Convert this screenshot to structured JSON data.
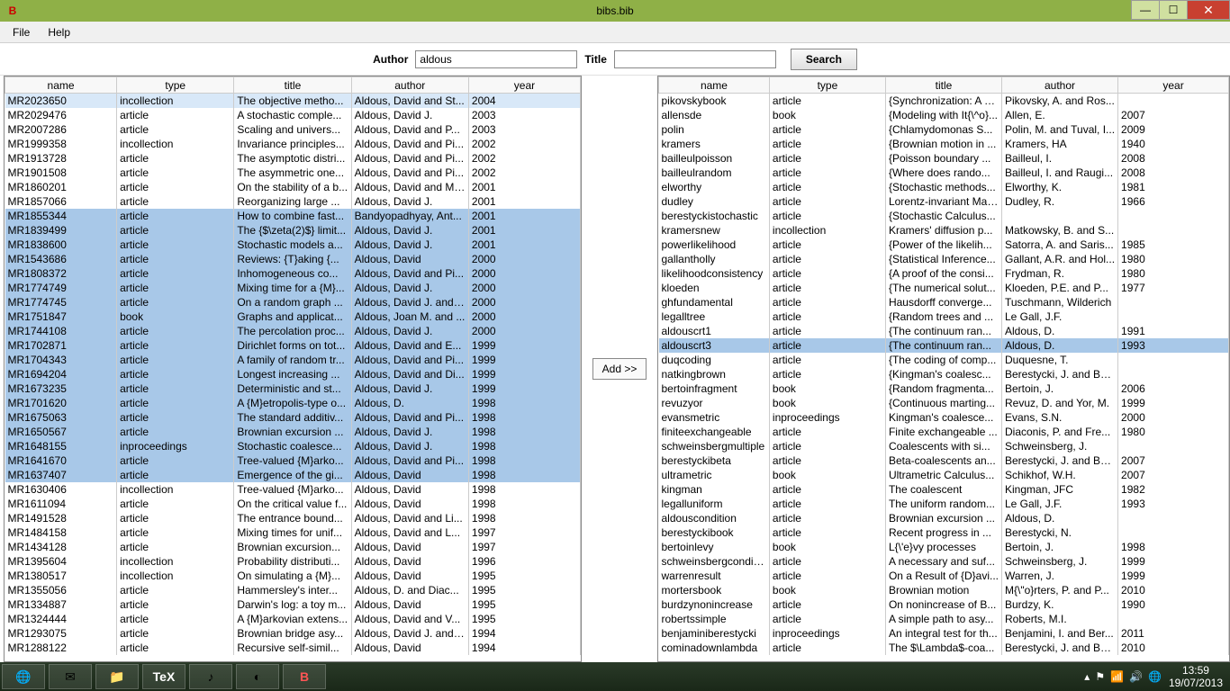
{
  "window": {
    "title": "bibs.bib"
  },
  "menu": {
    "file": "File",
    "help": "Help"
  },
  "search": {
    "author_label": "Author",
    "author_value": "aldous",
    "title_label": "Title",
    "title_value": "",
    "button": "Search"
  },
  "add_button": "Add >>",
  "columns": {
    "name": "name",
    "type": "type",
    "title": "title",
    "author": "author",
    "year": "year"
  },
  "left_rows": [
    {
      "sel": "partial",
      "name": "MR2023650",
      "type": "incollection",
      "title": "The objective metho...",
      "author": "Aldous, David and St...",
      "year": "2004"
    },
    {
      "sel": "",
      "name": "MR2029476",
      "type": "article",
      "title": "A stochastic comple...",
      "author": "Aldous, David J.",
      "year": "2003"
    },
    {
      "sel": "",
      "name": "MR2007286",
      "type": "article",
      "title": "Scaling and univers...",
      "author": "Aldous, David and P...",
      "year": "2003"
    },
    {
      "sel": "",
      "name": "MR1999358",
      "type": "incollection",
      "title": "Invariance principles...",
      "author": "Aldous, David and Pi...",
      "year": "2002"
    },
    {
      "sel": "",
      "name": "MR1913728",
      "type": "article",
      "title": "The asymptotic distri...",
      "author": "Aldous, David and Pi...",
      "year": "2002"
    },
    {
      "sel": "",
      "name": "MR1901508",
      "type": "article",
      "title": "The asymmetric one...",
      "author": "Aldous, David and Pi...",
      "year": "2002"
    },
    {
      "sel": "",
      "name": "MR1860201",
      "type": "article",
      "title": "On the stability of a b...",
      "author": "Aldous, David and Mi...",
      "year": "2001"
    },
    {
      "sel": "",
      "name": "MR1857066",
      "type": "article",
      "title": "Reorganizing large ...",
      "author": "Aldous, David J.",
      "year": "2001"
    },
    {
      "sel": "selected",
      "name": "MR1855344",
      "type": "article",
      "title": "How to combine fast...",
      "author": "Bandyopadhyay, Ant...",
      "year": "2001"
    },
    {
      "sel": "selected",
      "name": "MR1839499",
      "type": "article",
      "title": "The {$\\zeta(2)$} limit...",
      "author": "Aldous, David J.",
      "year": "2001"
    },
    {
      "sel": "selected",
      "name": "MR1838600",
      "type": "article",
      "title": "Stochastic models a...",
      "author": "Aldous, David J.",
      "year": "2001"
    },
    {
      "sel": "selected",
      "name": "MR1543686",
      "type": "article",
      "title": "Reviews: {T}aking {...",
      "author": "Aldous, David",
      "year": "2000"
    },
    {
      "sel": "selected",
      "name": "MR1808372",
      "type": "article",
      "title": "Inhomogeneous co...",
      "author": "Aldous, David and Pi...",
      "year": "2000"
    },
    {
      "sel": "selected",
      "name": "MR1774749",
      "type": "article",
      "title": "Mixing time for a {M}...",
      "author": "Aldous, David J.",
      "year": "2000"
    },
    {
      "sel": "selected",
      "name": "MR1774745",
      "type": "article",
      "title": "On a random graph ...",
      "author": "Aldous, David J. and ...",
      "year": "2000"
    },
    {
      "sel": "selected",
      "name": "MR1751847",
      "type": "book",
      "title": "Graphs and applicat...",
      "author": "Aldous, Joan M. and ...",
      "year": "2000"
    },
    {
      "sel": "selected",
      "name": "MR1744108",
      "type": "article",
      "title": "The percolation proc...",
      "author": "Aldous, David J.",
      "year": "2000"
    },
    {
      "sel": "selected",
      "name": "MR1702871",
      "type": "article",
      "title": "Dirichlet forms on tot...",
      "author": "Aldous, David and E...",
      "year": "1999"
    },
    {
      "sel": "selected",
      "name": "MR1704343",
      "type": "article",
      "title": "A family of random tr...",
      "author": "Aldous, David and Pi...",
      "year": "1999"
    },
    {
      "sel": "selected",
      "name": "MR1694204",
      "type": "article",
      "title": "Longest increasing ...",
      "author": "Aldous, David and Di...",
      "year": "1999"
    },
    {
      "sel": "selected",
      "name": "MR1673235",
      "type": "article",
      "title": "Deterministic and st...",
      "author": "Aldous, David J.",
      "year": "1999"
    },
    {
      "sel": "selected",
      "name": "MR1701620",
      "type": "article",
      "title": "A {M}etropolis-type o...",
      "author": "Aldous, D.",
      "year": "1998"
    },
    {
      "sel": "selected",
      "name": "MR1675063",
      "type": "article",
      "title": "The standard additiv...",
      "author": "Aldous, David and Pi...",
      "year": "1998"
    },
    {
      "sel": "selected",
      "name": "MR1650567",
      "type": "article",
      "title": "Brownian excursion ...",
      "author": "Aldous, David J.",
      "year": "1998"
    },
    {
      "sel": "selected",
      "name": "MR1648155",
      "type": "inproceedings",
      "title": "Stochastic coalesce...",
      "author": "Aldous, David J.",
      "year": "1998"
    },
    {
      "sel": "selected",
      "name": "MR1641670",
      "type": "article",
      "title": "Tree-valued {M}arko...",
      "author": "Aldous, David and Pi...",
      "year": "1998"
    },
    {
      "sel": "selected",
      "name": "MR1637407",
      "type": "article",
      "title": "Emergence of the gi...",
      "author": "Aldous, David",
      "year": "1998"
    },
    {
      "sel": "",
      "name": "MR1630406",
      "type": "incollection",
      "title": "Tree-valued {M}arko...",
      "author": "Aldous, David",
      "year": "1998"
    },
    {
      "sel": "",
      "name": "MR1611094",
      "type": "article",
      "title": "On the critical value f...",
      "author": "Aldous, David",
      "year": "1998"
    },
    {
      "sel": "",
      "name": "MR1491528",
      "type": "article",
      "title": "The entrance bound...",
      "author": "Aldous, David and Li...",
      "year": "1998"
    },
    {
      "sel": "",
      "name": "MR1484158",
      "type": "article",
      "title": "Mixing times for unif...",
      "author": "Aldous, David and L...",
      "year": "1997"
    },
    {
      "sel": "",
      "name": "MR1434128",
      "type": "article",
      "title": "Brownian excursion...",
      "author": "Aldous, David",
      "year": "1997"
    },
    {
      "sel": "",
      "name": "MR1395604",
      "type": "incollection",
      "title": "Probability distributi...",
      "author": "Aldous, David",
      "year": "1996"
    },
    {
      "sel": "",
      "name": "MR1380517",
      "type": "incollection",
      "title": "On simulating a {M}...",
      "author": "Aldous, David",
      "year": "1995"
    },
    {
      "sel": "",
      "name": "MR1355056",
      "type": "article",
      "title": "Hammersley's inter...",
      "author": "Aldous, D. and Diac...",
      "year": "1995"
    },
    {
      "sel": "",
      "name": "MR1334887",
      "type": "article",
      "title": "Darwin's log: a toy m...",
      "author": "Aldous, David",
      "year": "1995"
    },
    {
      "sel": "",
      "name": "MR1324444",
      "type": "article",
      "title": "A {M}arkovian extens...",
      "author": "Aldous, David and V...",
      "year": "1995"
    },
    {
      "sel": "",
      "name": "MR1293075",
      "type": "article",
      "title": "Brownian bridge asy...",
      "author": "Aldous, David J. and ...",
      "year": "1994"
    },
    {
      "sel": "",
      "name": "MR1288122",
      "type": "article",
      "title": "Recursive self-simil...",
      "author": "Aldous, David",
      "year": "1994"
    }
  ],
  "right_rows": [
    {
      "sel": "",
      "name": "pikovskybook",
      "type": "article",
      "title": "{Synchronization: A u...",
      "author": "Pikovsky, A. and Ros...",
      "year": ""
    },
    {
      "sel": "",
      "name": "allensde",
      "type": "book",
      "title": "{Modeling with It{\\^o}...",
      "author": "Allen, E.",
      "year": "2007"
    },
    {
      "sel": "",
      "name": "polin",
      "type": "article",
      "title": "{Chlamydomonas S...",
      "author": "Polin, M. and Tuval, I...",
      "year": "2009"
    },
    {
      "sel": "",
      "name": "kramers",
      "type": "article",
      "title": "{Brownian motion in ...",
      "author": "Kramers, HA",
      "year": "1940"
    },
    {
      "sel": "",
      "name": "bailleulpoisson",
      "type": "article",
      "title": "{Poisson boundary ...",
      "author": "Bailleul, I.",
      "year": "2008"
    },
    {
      "sel": "",
      "name": "bailleulrandom",
      "type": "article",
      "title": "{Where does rando...",
      "author": "Bailleul, I. and Raugi...",
      "year": "2008"
    },
    {
      "sel": "",
      "name": "elworthy",
      "type": "article",
      "title": "{Stochastic methods...",
      "author": "Elworthy, K.",
      "year": "1981"
    },
    {
      "sel": "",
      "name": "dudley",
      "type": "article",
      "title": "Lorentz-invariant Mar...",
      "author": "Dudley, R.",
      "year": "1966"
    },
    {
      "sel": "",
      "name": "berestyckistochastic",
      "type": "article",
      "title": "{Stochastic Calculus...",
      "author": "",
      "year": ""
    },
    {
      "sel": "",
      "name": "kramersnew",
      "type": "incollection",
      "title": "Kramers' diffusion p...",
      "author": "Matkowsky, B. and S...",
      "year": ""
    },
    {
      "sel": "",
      "name": "powerlikelihood",
      "type": "article",
      "title": "{Power of the likelih...",
      "author": "Satorra, A. and Saris...",
      "year": "1985"
    },
    {
      "sel": "",
      "name": "gallantholly",
      "type": "article",
      "title": "{Statistical Inference...",
      "author": "Gallant, A.R. and Hol...",
      "year": "1980"
    },
    {
      "sel": "",
      "name": "likelihoodconsistency",
      "type": "article",
      "title": "{A proof of the consi...",
      "author": "Frydman, R.",
      "year": "1980"
    },
    {
      "sel": "",
      "name": "kloeden",
      "type": "article",
      "title": "{The numerical solut...",
      "author": "Kloeden, P.E. and P...",
      "year": "1977"
    },
    {
      "sel": "",
      "name": "ghfundamental",
      "type": "article",
      "title": "Hausdorff converge...",
      "author": "Tuschmann, Wilderich",
      "year": ""
    },
    {
      "sel": "",
      "name": "legalltree",
      "type": "article",
      "title": "{Random trees and ...",
      "author": "Le Gall, J.F.",
      "year": ""
    },
    {
      "sel": "",
      "name": "aldouscrt1",
      "type": "article",
      "title": "{The continuum ran...",
      "author": "Aldous, D.",
      "year": "1991"
    },
    {
      "sel": "selected",
      "name": "aldouscrt3",
      "type": "article",
      "title": "{The continuum ran...",
      "author": "Aldous, D.",
      "year": "1993"
    },
    {
      "sel": "",
      "name": "duqcoding",
      "type": "article",
      "title": "{The coding of comp...",
      "author": "Duquesne, T.",
      "year": ""
    },
    {
      "sel": "",
      "name": "natkingbrown",
      "type": "article",
      "title": "{Kingman's coalesc...",
      "author": "Berestycki, J. and Be...",
      "year": ""
    },
    {
      "sel": "",
      "name": "bertoinfragment",
      "type": "book",
      "title": "{Random fragmenta...",
      "author": "Bertoin, J.",
      "year": "2006"
    },
    {
      "sel": "",
      "name": "revuzyor",
      "type": "book",
      "title": "{Continuous marting...",
      "author": "Revuz, D. and Yor, M.",
      "year": "1999"
    },
    {
      "sel": "",
      "name": "evansmetric",
      "type": "inproceedings",
      "title": "Kingman's coalesce...",
      "author": "Evans, S.N.",
      "year": "2000"
    },
    {
      "sel": "",
      "name": "finiteexchangeable",
      "type": "article",
      "title": "Finite exchangeable ...",
      "author": "Diaconis, P. and Fre...",
      "year": "1980"
    },
    {
      "sel": "",
      "name": "schweinsbergmultiple",
      "type": "article",
      "title": "Coalescents with si...",
      "author": "Schweinsberg, J.",
      "year": ""
    },
    {
      "sel": "",
      "name": "berestyckibeta",
      "type": "article",
      "title": "Beta-coalescents an...",
      "author": "Berestycki, J. and Be...",
      "year": "2007"
    },
    {
      "sel": "",
      "name": "ultrametric",
      "type": "book",
      "title": "Ultrametric Calculus...",
      "author": "Schikhof, W.H.",
      "year": "2007"
    },
    {
      "sel": "",
      "name": "kingman",
      "type": "article",
      "title": "The coalescent",
      "author": "Kingman, JFC",
      "year": "1982"
    },
    {
      "sel": "",
      "name": "legalluniform",
      "type": "article",
      "title": "The uniform random...",
      "author": "Le Gall, J.F.",
      "year": "1993"
    },
    {
      "sel": "",
      "name": "aldouscondition",
      "type": "article",
      "title": "Brownian excursion ...",
      "author": "Aldous, D.",
      "year": ""
    },
    {
      "sel": "",
      "name": "berestyckibook",
      "type": "article",
      "title": "Recent progress in ...",
      "author": "Berestycki, N.",
      "year": ""
    },
    {
      "sel": "",
      "name": "bertoinlevy",
      "type": "book",
      "title": "L{\\'e}vy processes",
      "author": "Bertoin, J.",
      "year": "1998"
    },
    {
      "sel": "",
      "name": "schweinsbergconditi...",
      "type": "article",
      "title": "A necessary and suf...",
      "author": "Schweinsberg, J.",
      "year": "1999"
    },
    {
      "sel": "",
      "name": "warrenresult",
      "type": "article",
      "title": "On a Result of {D}avi...",
      "author": "Warren, J.",
      "year": "1999"
    },
    {
      "sel": "",
      "name": "mortersbook",
      "type": "book",
      "title": "Brownian motion",
      "author": "M{\\\"o}rters, P. and P...",
      "year": "2010"
    },
    {
      "sel": "",
      "name": "burdzynonincrease",
      "type": "article",
      "title": "On nonincrease of B...",
      "author": "Burdzy, K.",
      "year": "1990"
    },
    {
      "sel": "",
      "name": "robertssimple",
      "type": "article",
      "title": "A simple path to asy...",
      "author": "Roberts, M.I.",
      "year": ""
    },
    {
      "sel": "",
      "name": "benjaminiberestycki",
      "type": "inproceedings",
      "title": "An integral test for th...",
      "author": "Benjamini, I. and Ber...",
      "year": "2011"
    },
    {
      "sel": "",
      "name": "cominadownlambda",
      "type": "article",
      "title": "The $\\Lambda$-coa...",
      "author": "Berestycki, J. and Be...",
      "year": "2010"
    }
  ],
  "tray": {
    "time": "13:59",
    "date": "19/07/2013"
  }
}
